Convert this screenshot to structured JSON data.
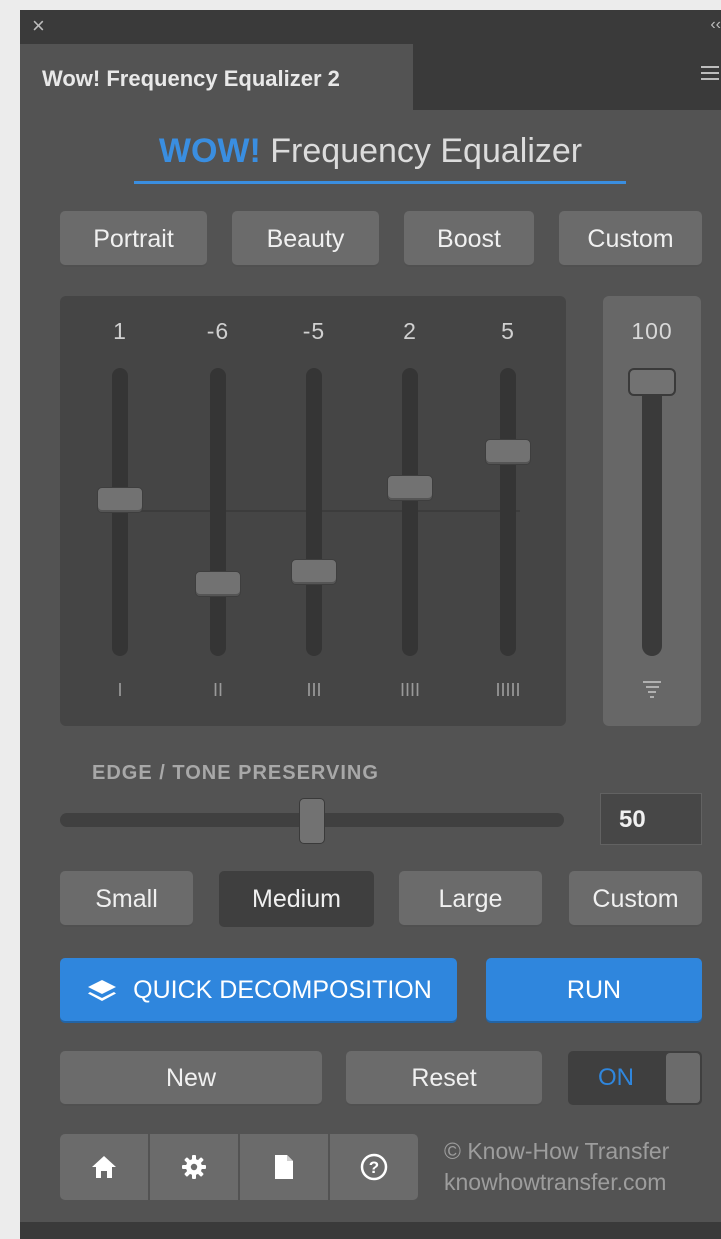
{
  "window": {
    "close_glyph": "×",
    "collapse_glyph": "‹‹",
    "tab_title": "Wow! Frequency Equalizer 2"
  },
  "header": {
    "wow": "WOW!",
    "title": "Frequency Equalizer"
  },
  "presets": [
    "Portrait",
    "Beauty",
    "Boost",
    "Custom"
  ],
  "equalizer": {
    "bands": [
      {
        "value": "1",
        "label": "I",
        "level": 1
      },
      {
        "value": "-6",
        "label": "II",
        "level": -6
      },
      {
        "value": "-5",
        "label": "III",
        "level": -5
      },
      {
        "value": "2",
        "label": "IIII",
        "level": 2
      },
      {
        "value": "5",
        "label": "IIIII",
        "level": 5
      }
    ],
    "range": [
      -12,
      12
    ],
    "master": {
      "value": "100",
      "level": 100
    }
  },
  "edge": {
    "label": "EDGE / TONE PRESERVING",
    "value": "50",
    "level": 50
  },
  "sizes": {
    "items": [
      "Small",
      "Medium",
      "Large",
      "Custom"
    ],
    "selected": "Medium"
  },
  "actions": {
    "quick": "QUICK DECOMPOSITION",
    "run": "RUN",
    "new": "New",
    "reset": "Reset",
    "toggle": "ON"
  },
  "footer": {
    "copyright": "© Know-How Transfer",
    "url": "knowhowtransfer.com"
  },
  "colors": {
    "accent": "#2f86dd",
    "panel": "#535353"
  }
}
